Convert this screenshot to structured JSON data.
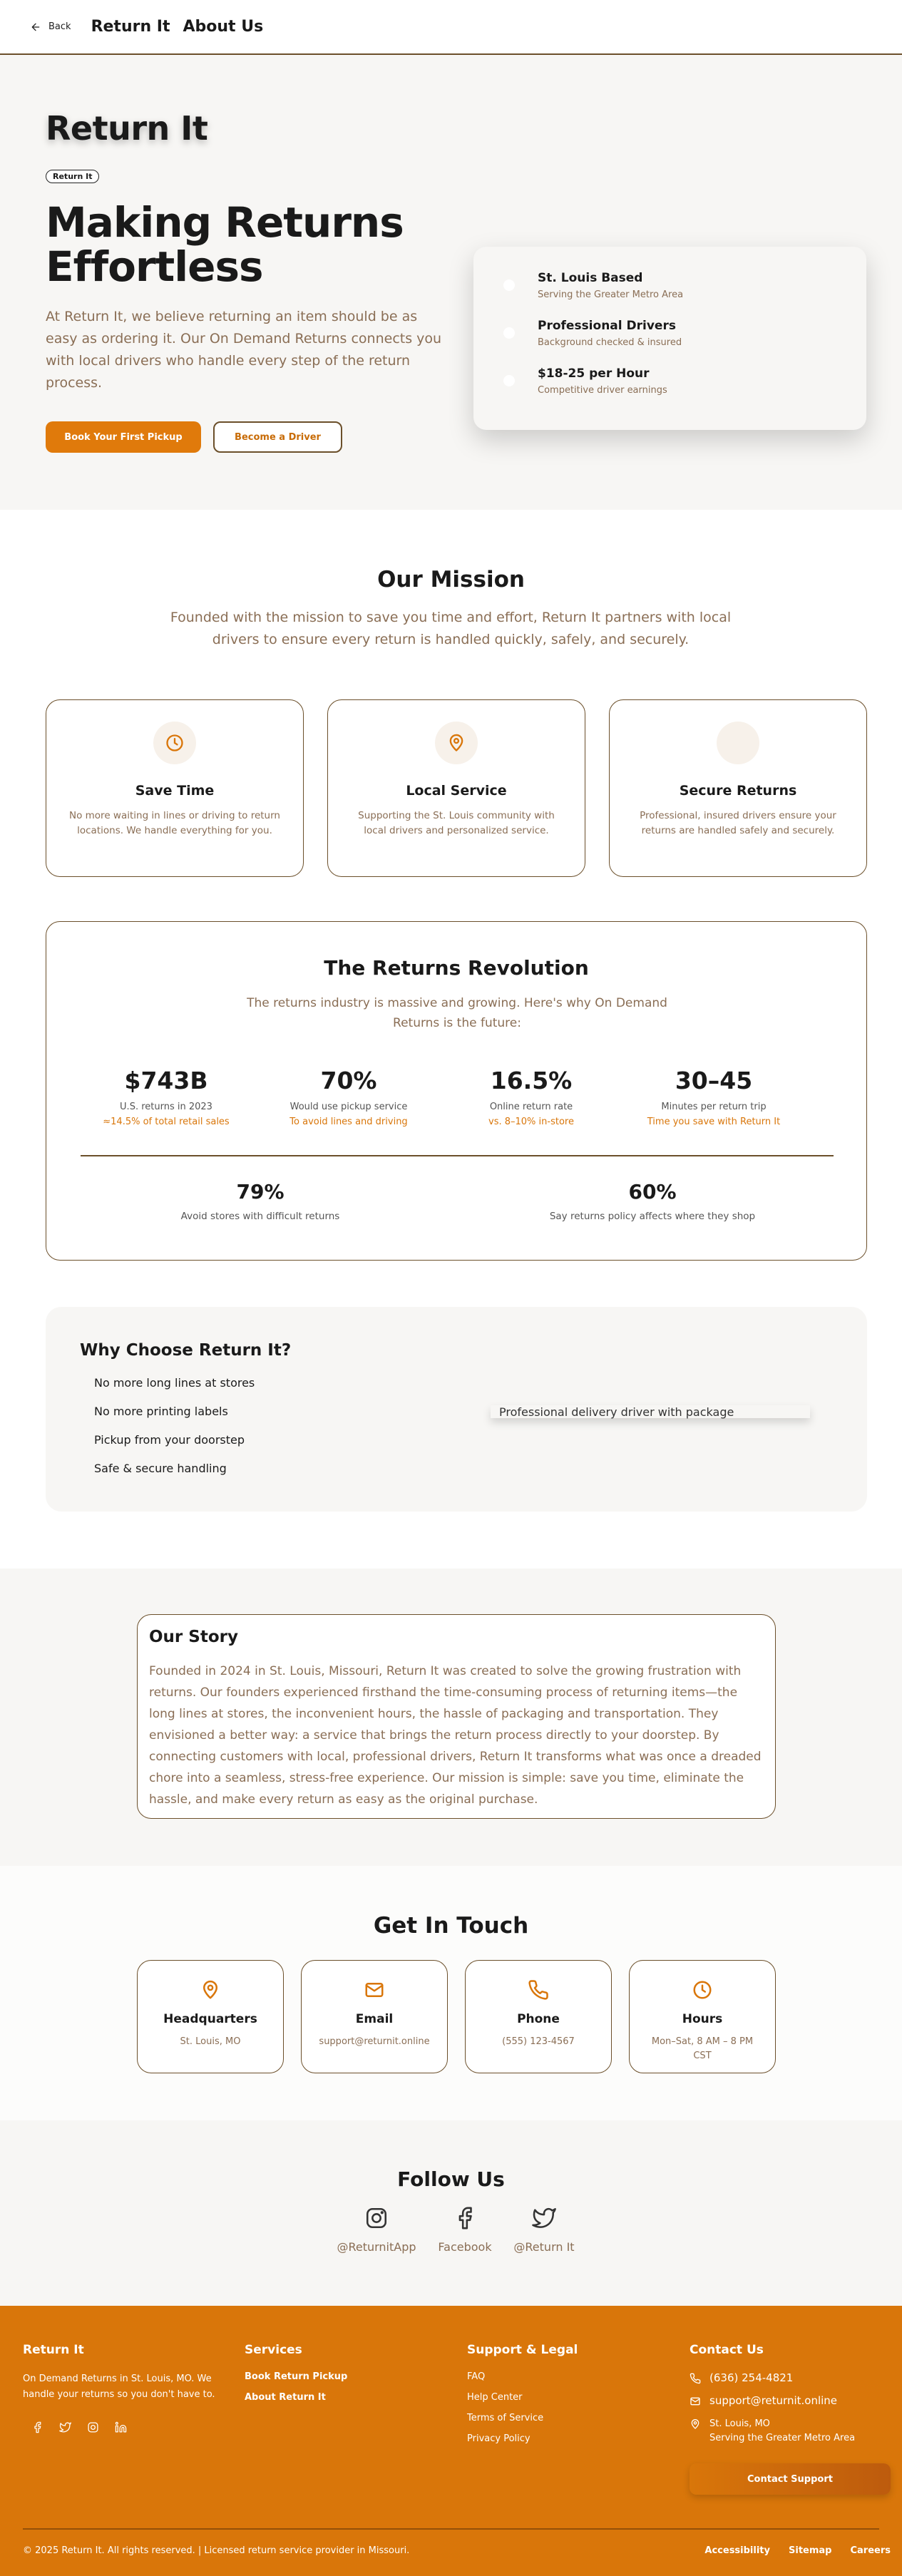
{
  "header": {
    "back_label": "Back",
    "brand": "Return It",
    "page_title": "About Us"
  },
  "hero": {
    "logo": "Return It",
    "badge": "Return It",
    "headline": "Making Returns Effortless",
    "body": "At Return It, we believe returning an item should be as easy as ordering it. Our On Demand Returns connects you with local drivers who handle every step of the return process.",
    "primary_cta": "Book Your First Pickup",
    "secondary_cta": "Become a Driver",
    "info_items": [
      {
        "title": "St. Louis Based",
        "subtitle": "Serving the Greater Metro Area"
      },
      {
        "title": "Professional Drivers",
        "subtitle": "Background checked & insured"
      },
      {
        "title": "$18-25 per Hour",
        "subtitle": "Competitive driver earnings"
      }
    ]
  },
  "mission": {
    "title": "Our Mission",
    "description": "Founded with the mission to save you time and effort, Return It partners with local drivers to ensure every return is handled quickly, safely, and securely.",
    "features": [
      {
        "icon": "clock-icon",
        "title": "Save Time",
        "text": "No more waiting in lines or driving to return locations. We handle everything for you."
      },
      {
        "icon": "map-pin-icon",
        "title": "Local Service",
        "text": "Supporting the St. Louis community with local drivers and personalized service."
      },
      {
        "icon": "shield-icon",
        "title": "Secure Returns",
        "text": "Professional, insured drivers ensure your returns are handled safely and securely."
      }
    ]
  },
  "revolution": {
    "title": "The Returns Revolution",
    "description": "The returns industry is massive and growing. Here's why On Demand Returns is the future:",
    "stats": [
      {
        "value": "$743B",
        "label": "U.S. returns in 2023",
        "sub": "≈14.5% of total retail sales"
      },
      {
        "value": "70%",
        "label": "Would use pickup service",
        "sub": "To avoid lines and driving"
      },
      {
        "value": "16.5%",
        "label": "Online return rate",
        "sub": "vs. 8–10% in-store"
      },
      {
        "value": "30–45",
        "label": "Minutes per return trip",
        "sub": "Time you save with Return It"
      }
    ],
    "stats2": [
      {
        "value": "79%",
        "label": "Avoid stores with difficult returns"
      },
      {
        "value": "60%",
        "label": "Say returns policy affects where they shop"
      }
    ]
  },
  "why": {
    "title": "Why Choose Return It?",
    "items": [
      "No more long lines at stores",
      "No more printing labels",
      "Pickup from your doorstep",
      "Safe & secure handling"
    ],
    "image_alt": "Professional delivery driver with package"
  },
  "story": {
    "title": "Our Story",
    "text": "Founded in 2024 in St. Louis, Missouri, Return It was created to solve the growing frustration with returns. Our founders experienced firsthand the time-consuming process of returning items—the long lines at stores, the inconvenient hours, the hassle of packaging and transportation. They envisioned a better way: a service that brings the return process directly to your doorstep. By connecting customers with local, professional drivers, Return It transforms what was once a dreaded chore into a seamless, stress-free experience. Our mission is simple: save you time, eliminate the hassle, and make every return as easy as the original purchase."
  },
  "contact": {
    "title": "Get In Touch",
    "cards": [
      {
        "icon": "map-pin-icon",
        "title": "Headquarters",
        "value": "St. Louis, MO"
      },
      {
        "icon": "mail-icon",
        "title": "Email",
        "value": "support@returnit.online"
      },
      {
        "icon": "phone-icon",
        "title": "Phone",
        "value": "(555) 123-4567"
      },
      {
        "icon": "clock-icon",
        "title": "Hours",
        "value": "Mon–Sat, 8 AM – 8 PM CST"
      }
    ]
  },
  "follow": {
    "title": "Follow Us",
    "links": [
      {
        "icon": "instagram-icon",
        "label": "@ReturnitApp"
      },
      {
        "icon": "facebook-icon",
        "label": "Facebook"
      },
      {
        "icon": "twitter-icon",
        "label": "@Return It"
      }
    ]
  },
  "footer": {
    "brand": "Return It",
    "tagline": "On Demand Returns in St. Louis, MO. We handle your returns so you don't have to.",
    "services_title": "Services",
    "services": [
      "Book Return Pickup",
      "About Return It"
    ],
    "support_title": "Support & Legal",
    "support": [
      "FAQ",
      "Help Center",
      "Terms of Service",
      "Privacy Policy"
    ],
    "contact_title": "Contact Us",
    "phone": "(636) 254-4821",
    "email": "support@returnit.online",
    "location": "St. Louis, MO",
    "location_sub": "Serving the Greater Metro Area",
    "contact_button": "Contact Support",
    "copyright": "© 2025 Return It. All rights reserved. | Licensed return service provider in Missouri.",
    "legal_links": [
      "Accessibility",
      "Sitemap",
      "Careers"
    ]
  },
  "colors": {
    "accent": "#e07a0b",
    "footer_bg": "#d9760a",
    "muted_text": "#8a6e55",
    "border": "#6b4f2a"
  }
}
